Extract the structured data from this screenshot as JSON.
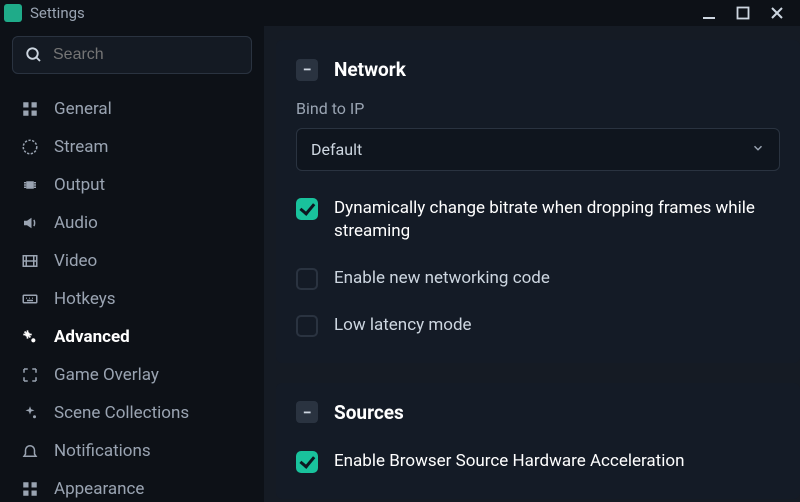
{
  "window": {
    "title": "Settings"
  },
  "sidebar": {
    "search_placeholder": "Search",
    "items": [
      {
        "label": "General"
      },
      {
        "label": "Stream"
      },
      {
        "label": "Output"
      },
      {
        "label": "Audio"
      },
      {
        "label": "Video"
      },
      {
        "label": "Hotkeys"
      },
      {
        "label": "Advanced"
      },
      {
        "label": "Game Overlay"
      },
      {
        "label": "Scene Collections"
      },
      {
        "label": "Notifications"
      },
      {
        "label": "Appearance"
      }
    ]
  },
  "sections": {
    "network": {
      "title": "Network",
      "bind_label": "Bind to IP",
      "bind_value": "Default",
      "opt_dynamic": "Dynamically change bitrate when dropping frames while streaming",
      "opt_newnet": "Enable new networking code",
      "opt_lowlat": "Low latency mode"
    },
    "sources": {
      "title": "Sources",
      "opt_browser_hw": "Enable Browser Source Hardware Acceleration"
    }
  }
}
